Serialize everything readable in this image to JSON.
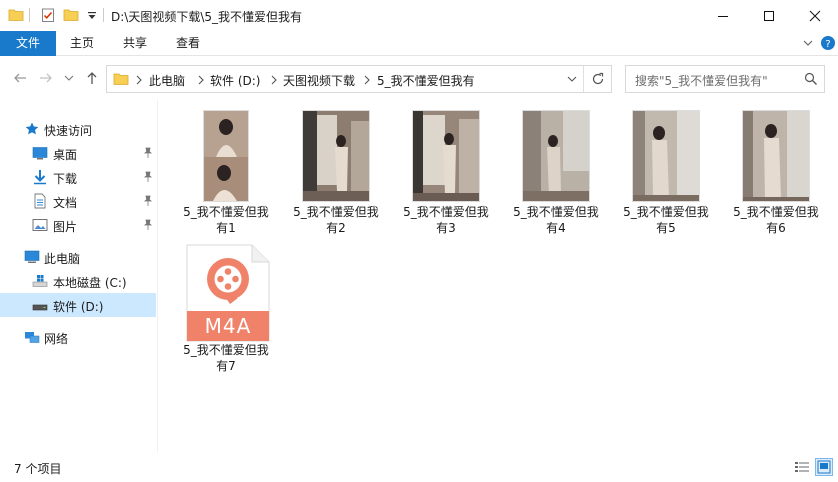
{
  "window": {
    "title": "D:\\天图视频下载\\5_我不懂爱但我有"
  },
  "ribbon": {
    "tabs": [
      "文件",
      "主页",
      "共享",
      "查看"
    ]
  },
  "address": {
    "crumbs": [
      "此电脑",
      "软件 (D:)",
      "天图视频下载",
      "5_我不懂爱但我有"
    ]
  },
  "search": {
    "placeholder": "搜索\"5_我不懂爱但我有\""
  },
  "nav": {
    "quick_access": "快速访问",
    "desktop": "桌面",
    "downloads": "下载",
    "documents": "文档",
    "pictures": "图片",
    "this_pc": "此电脑",
    "local_c": "本地磁盘 (C:)",
    "drive_d": "软件 (D:)",
    "network": "网络"
  },
  "files": [
    {
      "line1": "5_我不懂爱但我",
      "line2": "有1",
      "kind": "video"
    },
    {
      "line1": "5_我不懂爱但我",
      "line2": "有2",
      "kind": "video"
    },
    {
      "line1": "5_我不懂爱但我",
      "line2": "有3",
      "kind": "video"
    },
    {
      "line1": "5_我不懂爱但我",
      "line2": "有4",
      "kind": "video"
    },
    {
      "line1": "5_我不懂爱但我",
      "line2": "有5",
      "kind": "video"
    },
    {
      "line1": "5_我不懂爱但我",
      "line2": "有6",
      "kind": "video"
    },
    {
      "line1": "5_我不懂爱但我",
      "line2": "有7",
      "kind": "audio",
      "badge": "M4A"
    }
  ],
  "status": {
    "count": "7 个项目"
  },
  "colors": {
    "accent": "#1979ca",
    "selected": "#cce8ff",
    "m4a_orange": "#f0826a"
  }
}
